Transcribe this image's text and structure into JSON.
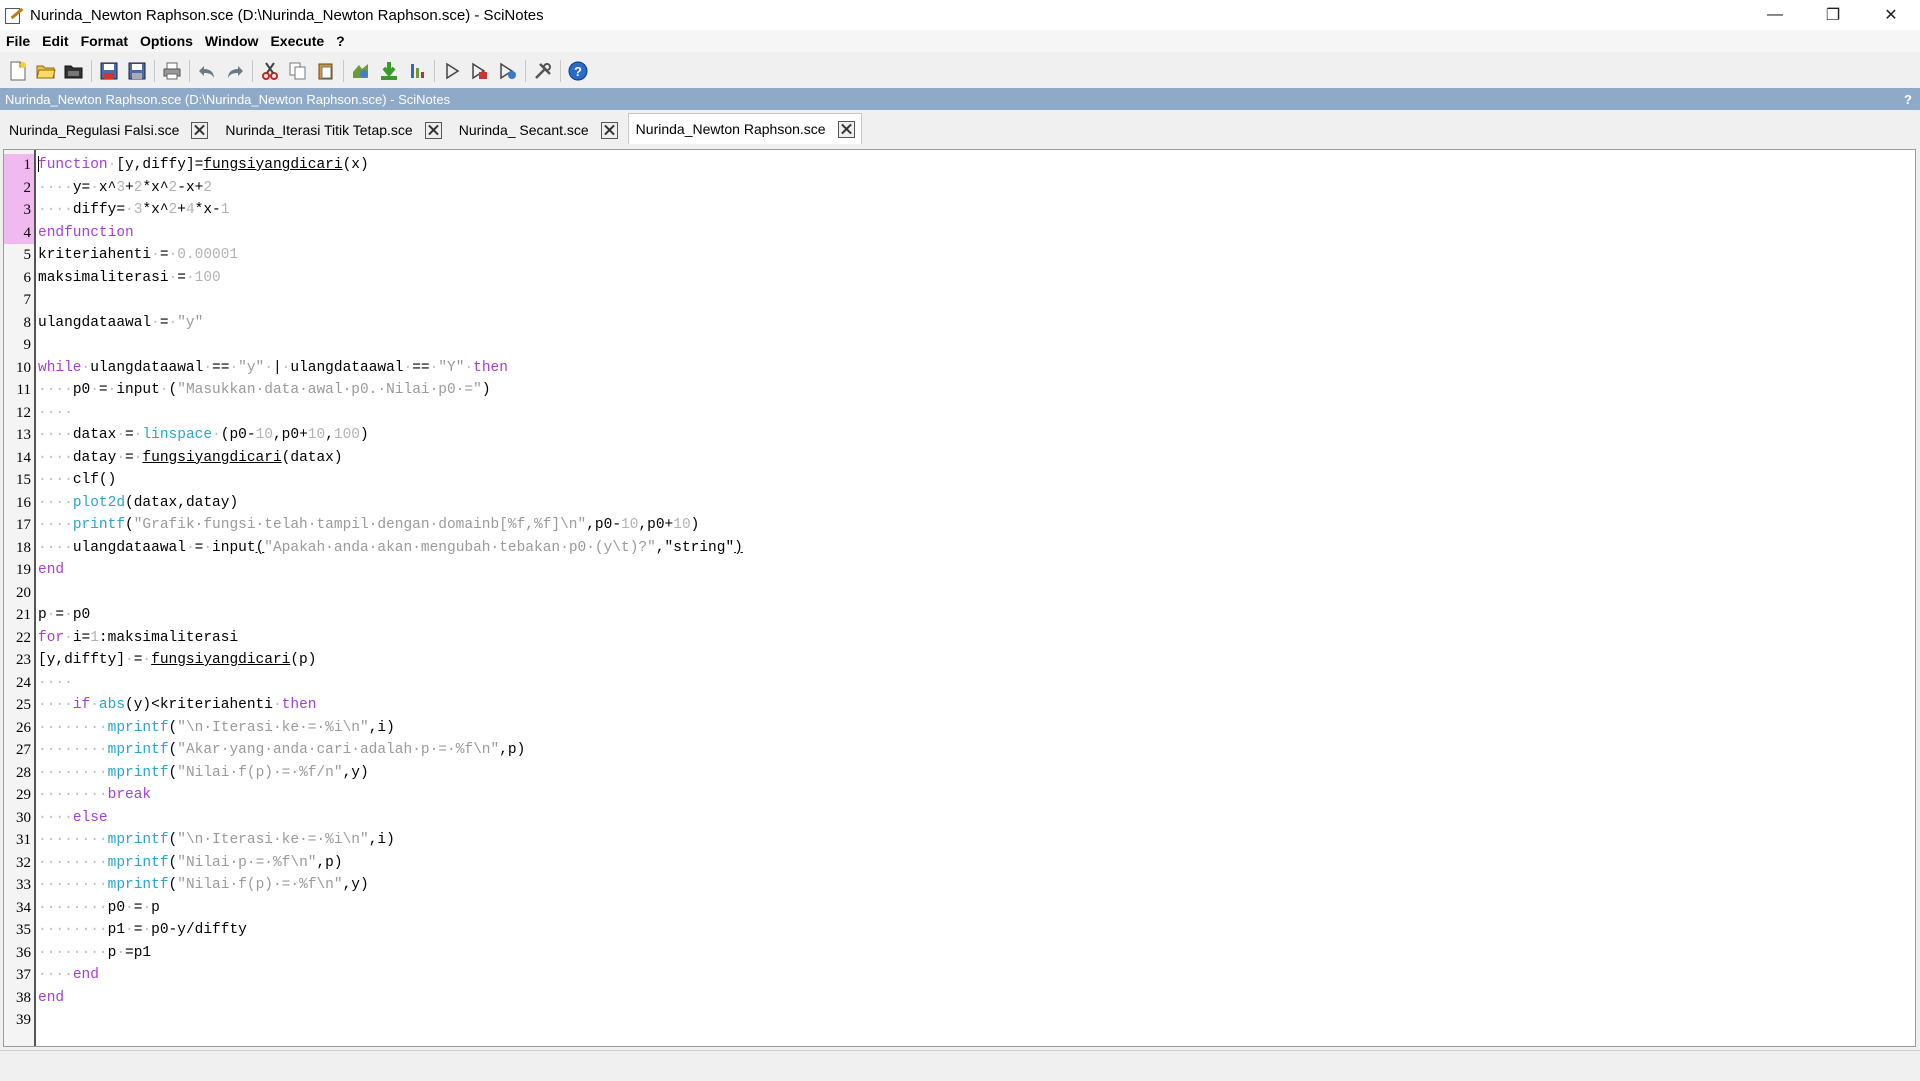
{
  "window": {
    "title": "Nurinda_Newton Raphson.sce (D:\\Nurinda_Newton Raphson.sce) - SciNotes",
    "controls": [
      "—",
      "❐",
      "✕"
    ]
  },
  "menu": [
    "File",
    "Edit",
    "Format",
    "Options",
    "Window",
    "Execute",
    "?"
  ],
  "toolbar": {
    "icons": [
      "new-file-icon",
      "open-file-icon",
      "open-recent-icon",
      "save-icon",
      "save-as-icon",
      "print-icon",
      "undo-icon",
      "redo-icon",
      "cut-icon",
      "copy-icon",
      "paste-icon",
      "execute-file-icon",
      "load-into-scilab-icon",
      "execute-menu-icon",
      "run-icon",
      "run-to-cursor-icon",
      "evaluate-selection-icon",
      "tools-icon",
      "help-icon"
    ]
  },
  "infobar": {
    "text": "Nurinda_Newton Raphson.sce (D:\\Nurinda_Newton Raphson.sce) - SciNotes",
    "help": "?"
  },
  "tabs": [
    {
      "label": "Nurinda_Regulasi Falsi.sce",
      "active": false
    },
    {
      "label": "Nurinda_Iterasi Titik Tetap.sce",
      "active": false
    },
    {
      "label": "Nurinda_ Secant.sce",
      "active": false
    },
    {
      "label": "Nurinda_Newton Raphson.sce",
      "active": true
    }
  ],
  "colors": {
    "keyword": "#a63ed8",
    "function": "#28a7c9",
    "string": "#9a9a9a",
    "number": "#b3b3b3",
    "infobar": "#8fa9c9",
    "modified_gutter": "#f0b9f0"
  },
  "modified_lines": [
    1,
    4
  ],
  "code": [
    [
      [
        "kw",
        "function"
      ],
      [
        "ws",
        "·"
      ],
      [
        "",
        "[y,diffy]="
      ],
      [
        "ul",
        "fungsiyangdicari"
      ],
      [
        "",
        "(x)"
      ]
    ],
    [
      [
        "ws",
        "····"
      ],
      [
        "",
        "y="
      ],
      [
        "ws",
        "·"
      ],
      [
        "",
        "x^"
      ],
      [
        "num",
        "3"
      ],
      [
        "",
        "+"
      ],
      [
        "num",
        "2"
      ],
      [
        "",
        "*x^"
      ],
      [
        "num",
        "2"
      ],
      [
        "",
        "-x+"
      ],
      [
        "num",
        "2"
      ]
    ],
    [
      [
        "ws",
        "····"
      ],
      [
        "",
        "diffy="
      ],
      [
        "ws",
        "·"
      ],
      [
        "num",
        "3"
      ],
      [
        "",
        "*x^"
      ],
      [
        "num",
        "2"
      ],
      [
        "",
        "+"
      ],
      [
        "num",
        "4"
      ],
      [
        "",
        "*x-"
      ],
      [
        "num",
        "1"
      ]
    ],
    [
      [
        "kw",
        "endfunction"
      ]
    ],
    [
      [
        "",
        "kriteriahenti"
      ],
      [
        "ws",
        "·"
      ],
      [
        "",
        "="
      ],
      [
        "ws",
        "·"
      ],
      [
        "num",
        "0.00001"
      ]
    ],
    [
      [
        "",
        "maksimaliterasi"
      ],
      [
        "ws",
        "·"
      ],
      [
        "",
        "="
      ],
      [
        "ws",
        "·"
      ],
      [
        "num",
        "100"
      ]
    ],
    [],
    [
      [
        "",
        "ulangdataawal"
      ],
      [
        "ws",
        "·"
      ],
      [
        "",
        "="
      ],
      [
        "ws",
        "·"
      ],
      [
        "str",
        "\"y\""
      ]
    ],
    [],
    [
      [
        "kw",
        "while"
      ],
      [
        "ws",
        "·"
      ],
      [
        "",
        "ulangdataawal"
      ],
      [
        "ws",
        "·"
      ],
      [
        "",
        "=="
      ],
      [
        "ws",
        "·"
      ],
      [
        "str",
        "\"y\""
      ],
      [
        "ws",
        "·"
      ],
      [
        "",
        "|"
      ],
      [
        "ws",
        "·"
      ],
      [
        "",
        "ulangdataawal"
      ],
      [
        "ws",
        "·"
      ],
      [
        "",
        "=="
      ],
      [
        "ws",
        "·"
      ],
      [
        "str",
        "\"Y\""
      ],
      [
        "ws",
        "·"
      ],
      [
        "kw",
        "then"
      ]
    ],
    [
      [
        "ws",
        "····"
      ],
      [
        "",
        "p0"
      ],
      [
        "ws",
        "·"
      ],
      [
        "",
        "="
      ],
      [
        "ws",
        "·"
      ],
      [
        "",
        "input"
      ],
      [
        "ws",
        "·"
      ],
      [
        "",
        "("
      ],
      [
        "str",
        "\"Masukkan·data·awal·p0.·Nilai·p0·=\""
      ],
      [
        "",
        ")"
      ]
    ],
    [
      [
        "ws",
        "····"
      ]
    ],
    [
      [
        "ws",
        "····"
      ],
      [
        "",
        "datax"
      ],
      [
        "ws",
        "·"
      ],
      [
        "",
        "="
      ],
      [
        "ws",
        "·"
      ],
      [
        "fn",
        "linspace"
      ],
      [
        "ws",
        "·"
      ],
      [
        "",
        "(p0-"
      ],
      [
        "num",
        "10"
      ],
      [
        "",
        ",p0+"
      ],
      [
        "num",
        "10"
      ],
      [
        "",
        ","
      ],
      [
        "num",
        "100"
      ],
      [
        "",
        ")"
      ]
    ],
    [
      [
        "ws",
        "····"
      ],
      [
        "",
        "datay"
      ],
      [
        "ws",
        "·"
      ],
      [
        "",
        "="
      ],
      [
        "ws",
        "·"
      ],
      [
        "ul",
        "fungsiyangdicari"
      ],
      [
        "",
        "(datax)"
      ]
    ],
    [
      [
        "ws",
        "····"
      ],
      [
        "",
        "clf()"
      ]
    ],
    [
      [
        "ws",
        "····"
      ],
      [
        "fn",
        "plot2d"
      ],
      [
        "",
        "(datax,datay)"
      ]
    ],
    [
      [
        "ws",
        "····"
      ],
      [
        "fn",
        "printf"
      ],
      [
        "",
        "("
      ],
      [
        "str",
        "\"Grafik·fungsi·telah·tampil·dengan·domainb[%f,%f]\\n\""
      ],
      [
        "",
        ",p0-"
      ],
      [
        "num",
        "10"
      ],
      [
        "",
        ",p0+"
      ],
      [
        "num",
        "10"
      ],
      [
        "",
        ")"
      ]
    ],
    [
      [
        "ws",
        "····"
      ],
      [
        "",
        "ulangdataawal"
      ],
      [
        "ws",
        "·"
      ],
      [
        "",
        "="
      ],
      [
        "ws",
        "·"
      ],
      [
        "",
        "input"
      ],
      [
        "ul",
        "("
      ],
      [
        "str",
        "\"Apakah·anda·akan·mengubah·tebakan·p0·(y\\t)?\""
      ],
      [
        "",
        ",\"string\""
      ],
      [
        "ul",
        ")"
      ]
    ],
    [
      [
        "kw",
        "end"
      ]
    ],
    [],
    [
      [
        "",
        "p"
      ],
      [
        "ws",
        "·"
      ],
      [
        "",
        "="
      ],
      [
        "ws",
        "·"
      ],
      [
        "",
        "p0"
      ]
    ],
    [
      [
        "kw",
        "for"
      ],
      [
        "ws",
        "·"
      ],
      [
        "",
        "i="
      ],
      [
        "num",
        "1"
      ],
      [
        "",
        ":maksimaliterasi"
      ]
    ],
    [
      [
        "",
        "[y,diffty]"
      ],
      [
        "ws",
        "·"
      ],
      [
        "",
        "="
      ],
      [
        "ws",
        "·"
      ],
      [
        "ul",
        "fungsiyangdicari"
      ],
      [
        "",
        "(p)"
      ]
    ],
    [
      [
        "ws",
        "····"
      ]
    ],
    [
      [
        "ws",
        "····"
      ],
      [
        "kw",
        "if"
      ],
      [
        "ws",
        "·"
      ],
      [
        "fn",
        "abs"
      ],
      [
        "",
        "(y)<kriteriahenti"
      ],
      [
        "ws",
        "·"
      ],
      [
        "kw",
        "then"
      ]
    ],
    [
      [
        "ws",
        "········"
      ],
      [
        "fn",
        "mprintf"
      ],
      [
        "",
        "("
      ],
      [
        "str",
        "\"\\n·Iterasi·ke·=·%i\\n\""
      ],
      [
        "",
        ",i)"
      ]
    ],
    [
      [
        "ws",
        "········"
      ],
      [
        "fn",
        "mprintf"
      ],
      [
        "",
        "("
      ],
      [
        "str",
        "\"Akar·yang·anda·cari·adalah·p·=·%f\\n\""
      ],
      [
        "",
        ",p)"
      ]
    ],
    [
      [
        "ws",
        "········"
      ],
      [
        "fn",
        "mprintf"
      ],
      [
        "",
        "("
      ],
      [
        "str",
        "\"Nilai·f(p)·=·%f/n\""
      ],
      [
        "",
        ",y)"
      ]
    ],
    [
      [
        "ws",
        "········"
      ],
      [
        "kw",
        "break"
      ]
    ],
    [
      [
        "ws",
        "····"
      ],
      [
        "kw",
        "else"
      ]
    ],
    [
      [
        "ws",
        "········"
      ],
      [
        "fn",
        "mprintf"
      ],
      [
        "",
        "("
      ],
      [
        "str",
        "\"\\n·Iterasi·ke·=·%i\\n\""
      ],
      [
        "",
        ",i)"
      ]
    ],
    [
      [
        "ws",
        "········"
      ],
      [
        "fn",
        "mprintf"
      ],
      [
        "",
        "("
      ],
      [
        "str",
        "\"Nilai·p·=·%f\\n\""
      ],
      [
        "",
        ",p)"
      ]
    ],
    [
      [
        "ws",
        "········"
      ],
      [
        "fn",
        "mprintf"
      ],
      [
        "",
        "("
      ],
      [
        "str",
        "\"Nilai·f(p)·=·%f\\n\""
      ],
      [
        "",
        ",y)"
      ]
    ],
    [
      [
        "ws",
        "········"
      ],
      [
        "",
        "p0"
      ],
      [
        "ws",
        "·"
      ],
      [
        "",
        "="
      ],
      [
        "ws",
        "·"
      ],
      [
        "",
        "p"
      ]
    ],
    [
      [
        "ws",
        "········"
      ],
      [
        "",
        "p1"
      ],
      [
        "ws",
        "·"
      ],
      [
        "",
        "="
      ],
      [
        "ws",
        "·"
      ],
      [
        "",
        "p0-y/diffty"
      ]
    ],
    [
      [
        "ws",
        "········"
      ],
      [
        "",
        "p"
      ],
      [
        "ws",
        "·"
      ],
      [
        "",
        "=p1"
      ]
    ],
    [
      [
        "ws",
        "····"
      ],
      [
        "kw",
        "end"
      ]
    ],
    [
      [
        "kw",
        "end"
      ]
    ],
    []
  ]
}
